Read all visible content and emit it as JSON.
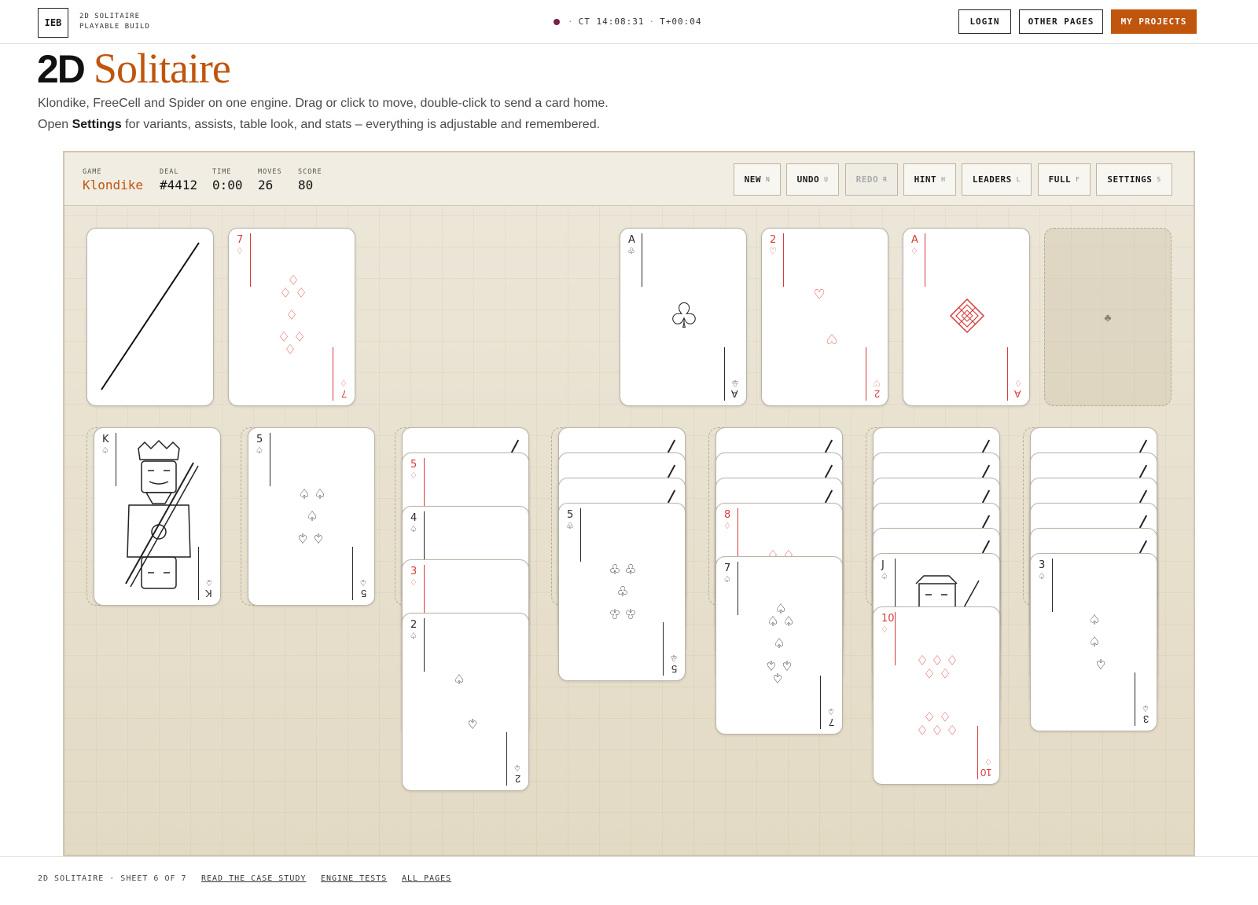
{
  "header": {
    "logo": "IEB",
    "brand_line1": "2D SOLITAIRE",
    "brand_line2": "PLAYABLE BUILD",
    "clock": "CT 14:08:31",
    "elapsed": "T+00:04",
    "login": "LOGIN",
    "other_pages": "OTHER PAGES",
    "my_projects": "MY PROJECTS"
  },
  "hero": {
    "title_bold": "2D",
    "title_serif": "Solitaire",
    "desc_line1": "Klondike, FreeCell and Spider on one engine. Drag or click to move, double-click to send a card home.",
    "desc_open": "Open",
    "desc_settings": "Settings",
    "desc_rest": "for variants, assists, table look, and stats – everything is adjustable and remembered."
  },
  "hud": {
    "game_label": "GAME",
    "game": "Klondike",
    "deal_label": "DEAL",
    "deal": "#4412",
    "time_label": "TIME",
    "time": "0:00",
    "moves_label": "MOVES",
    "moves": "26",
    "score_label": "SCORE",
    "score": "80",
    "buttons": [
      {
        "label": "NEW",
        "key": "N"
      },
      {
        "label": "UNDO",
        "key": "U"
      },
      {
        "label": "REDO",
        "key": "R"
      },
      {
        "label": "HINT",
        "key": "H"
      },
      {
        "label": "LEADERS",
        "key": "L"
      },
      {
        "label": "FULL",
        "key": "F"
      },
      {
        "label": "SETTINGS",
        "key": "S"
      }
    ]
  },
  "cards": {
    "waste": {
      "rank": "7",
      "suit": "♢"
    },
    "foundation_clubs": {
      "rank": "A",
      "suit": "♧"
    },
    "foundation_hearts": {
      "rank": "2",
      "suit": "♡"
    },
    "foundation_diamonds": {
      "rank": "A",
      "suit": "♢"
    },
    "empty_foundation_suit": "♣",
    "t1": {
      "rank": "K",
      "suit": "♤"
    },
    "t2": {
      "rank": "5",
      "suit": "♤"
    },
    "t3a": {
      "rank": "5",
      "suit": "♢"
    },
    "t3b": {
      "rank": "4",
      "suit": "♤"
    },
    "t3c": {
      "rank": "3",
      "suit": "♢"
    },
    "t3d": {
      "rank": "2",
      "suit": "♤"
    },
    "t4": {
      "rank": "5",
      "suit": "♧"
    },
    "t5a": {
      "rank": "8",
      "suit": "♢"
    },
    "t5b": {
      "rank": "7",
      "suit": "♤"
    },
    "t6a": {
      "rank": "J",
      "suit": "♤"
    },
    "t6b": {
      "rank": "10",
      "suit": "♢"
    },
    "t7": {
      "rank": "3",
      "suit": "♤"
    }
  },
  "footer": {
    "sheet": "2D SOLITAIRE · SHEET 6 OF 7",
    "case_study": "READ THE CASE STUDY",
    "engine_tests": "ENGINE TESTS",
    "all_pages": "ALL PAGES"
  },
  "colors": {
    "accent": "#c0550d",
    "red_suit": "#d83a3a",
    "dot": "#7a1f48"
  }
}
